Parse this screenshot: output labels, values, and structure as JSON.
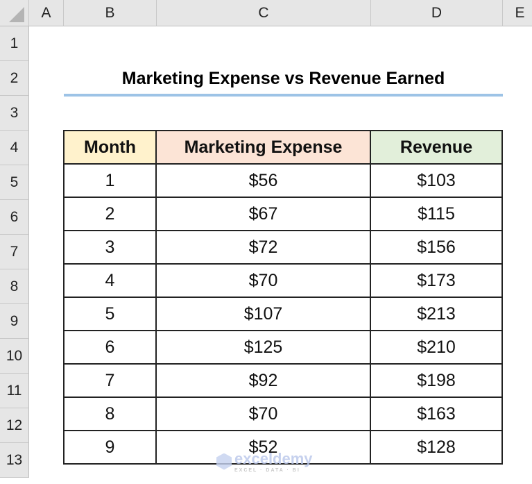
{
  "columns": [
    "A",
    "B",
    "C",
    "D",
    "E"
  ],
  "rows": [
    "1",
    "2",
    "3",
    "4",
    "5",
    "6",
    "7",
    "8",
    "9",
    "10",
    "11",
    "12",
    "13"
  ],
  "title": "Marketing Expense vs Revenue Earned",
  "table": {
    "headers": [
      "Month",
      "Marketing Expense",
      "Revenue"
    ],
    "header_colors": [
      "#fff2cc",
      "#fce4d6",
      "#e2efda"
    ],
    "rows": [
      [
        "1",
        "$56",
        "$103"
      ],
      [
        "2",
        "$67",
        "$115"
      ],
      [
        "3",
        "$72",
        "$156"
      ],
      [
        "4",
        "$70",
        "$173"
      ],
      [
        "5",
        "$107",
        "$213"
      ],
      [
        "6",
        "$125",
        "$210"
      ],
      [
        "7",
        "$92",
        "$198"
      ],
      [
        "8",
        "$70",
        "$163"
      ],
      [
        "9",
        "$52",
        "$128"
      ]
    ]
  },
  "watermark": {
    "name": "exceldemy",
    "tagline": "EXCEL · DATA · BI"
  }
}
